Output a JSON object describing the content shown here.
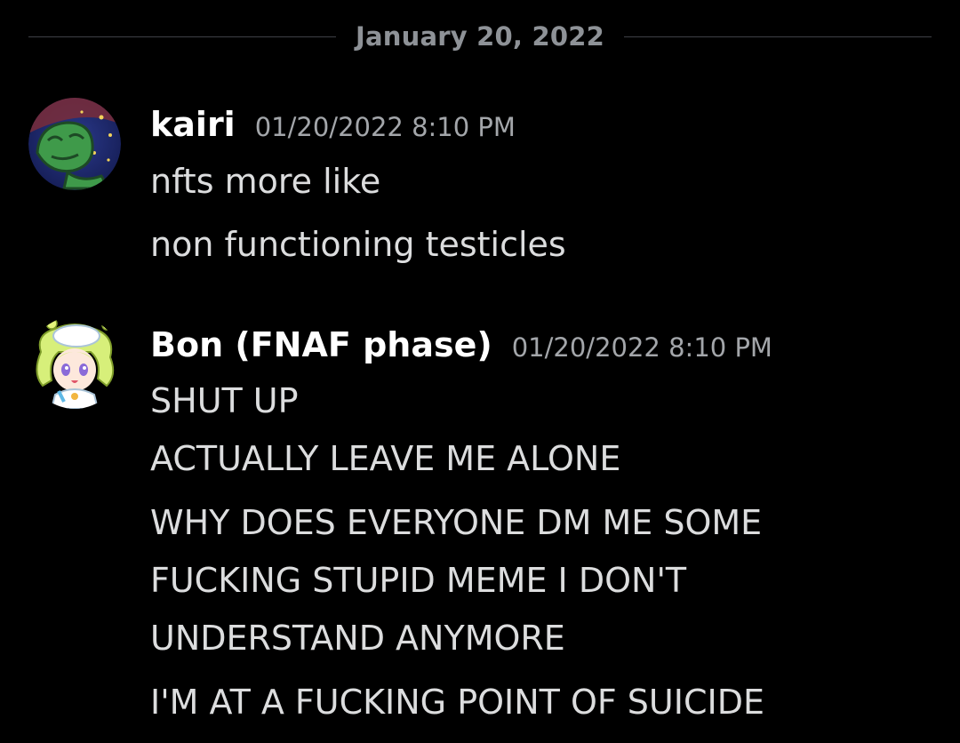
{
  "date_divider": "January 20, 2022",
  "messages": [
    {
      "author": "kairi",
      "timestamp": "01/20/2022 8:10 PM",
      "avatar_icon": "frog-sleeping-avatar-icon",
      "lines": [
        "nfts more like",
        "non functioning testicles"
      ]
    },
    {
      "author": "Bon (FNAF phase)",
      "timestamp": "01/20/2022 8:10 PM",
      "avatar_icon": "anime-girl-avatar-icon",
      "lines": [
        "SHUT UP",
        "ACTUALLY LEAVE ME ALONE",
        "WHY DOES EVERYONE DM ME SOME",
        "FUCKING STUPID MEME I DON'T",
        "UNDERSTAND ANYMORE",
        "I'M AT A FUCKING POINT OF SUICIDE"
      ]
    }
  ],
  "colors": {
    "background": "#000000",
    "username": "#ffffff",
    "message_text": "#dcddde",
    "timestamp": "#a3a6aa",
    "divider": "#3f4147"
  }
}
